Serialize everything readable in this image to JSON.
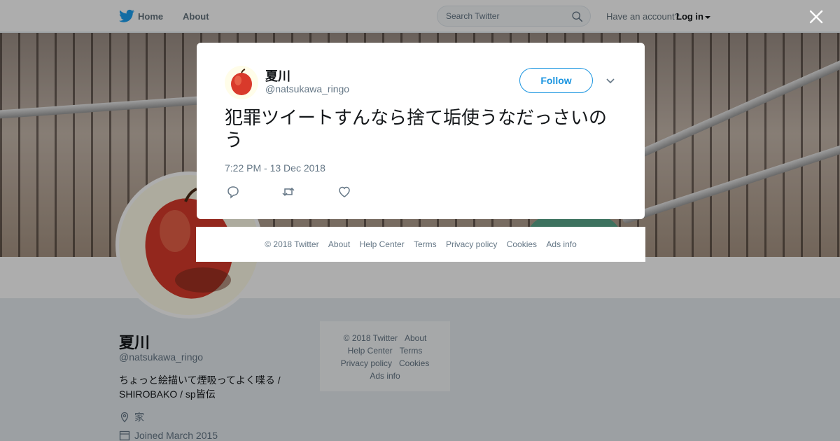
{
  "nav": {
    "home": "Home",
    "about": "About",
    "search_placeholder": "Search Twitter",
    "have_account": "Have an account?",
    "login": "Log in"
  },
  "profile": {
    "name": "夏川",
    "handle": "@natsukawa_ringo",
    "bio": "ちょっと絵描いて煙吸ってよく喋る / SHIROBAKO / sp皆伝",
    "location": "家",
    "joined": "Joined March 2015"
  },
  "side_footer": {
    "copyright": "© 2018 Twitter",
    "about": "About",
    "help": "Help Center",
    "terms": "Terms",
    "privacy": "Privacy policy",
    "cookies": "Cookies",
    "ads": "Ads info"
  },
  "tweet": {
    "name": "夏川",
    "handle": "@natsukawa_ringo",
    "follow_label": "Follow",
    "text": "犯罪ツイートすんなら捨て垢使うなだっさいのう",
    "timestamp": "7:22 PM - 13 Dec 2018"
  },
  "modal_footer": {
    "copyright": "© 2018 Twitter",
    "about": "About",
    "help": "Help Center",
    "terms": "Terms",
    "privacy": "Privacy policy",
    "cookies": "Cookies",
    "ads": "Ads info"
  },
  "icons": {
    "brand": "twitter-bird-icon",
    "search": "search-icon",
    "close": "close-icon",
    "reply": "reply-icon",
    "retweet": "retweet-icon",
    "like": "heart-icon",
    "more": "chevron-down-icon",
    "location": "location-pin-icon",
    "calendar": "calendar-icon"
  },
  "colors": {
    "brand_blue": "#1da1f2",
    "follow_blue": "#1b95e0",
    "text_primary": "#14171a",
    "text_secondary": "#657786",
    "apple_red": "#d93a2b"
  }
}
